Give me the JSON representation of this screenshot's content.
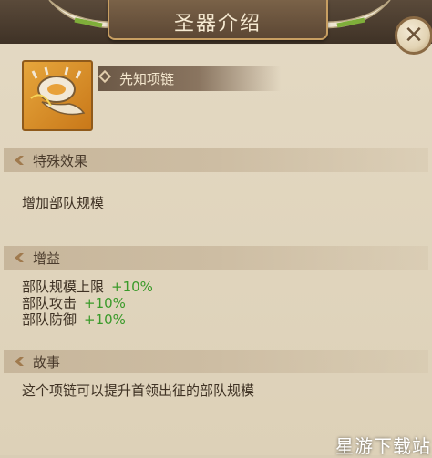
{
  "header": {
    "title": "圣器介绍"
  },
  "item": {
    "name": "先知项链",
    "icon": "horn-necklace-icon"
  },
  "sections": {
    "effect": {
      "title": "特殊效果",
      "text": "增加部队规模"
    },
    "bonus": {
      "title": "增益",
      "rows": [
        {
          "label": "部队规模上限",
          "value": "+10%"
        },
        {
          "label": "部队攻击",
          "value": "+10%"
        },
        {
          "label": "部队防御",
          "value": "+10%"
        }
      ]
    },
    "story": {
      "title": "故事",
      "text": "这个项链可以提升首领出征的部队规模"
    }
  },
  "watermark": "星游下载站",
  "colors": {
    "bonus_green": "#3a9a2a",
    "header_brown": "#5a4a3a",
    "gold_border": "#c89f62"
  }
}
